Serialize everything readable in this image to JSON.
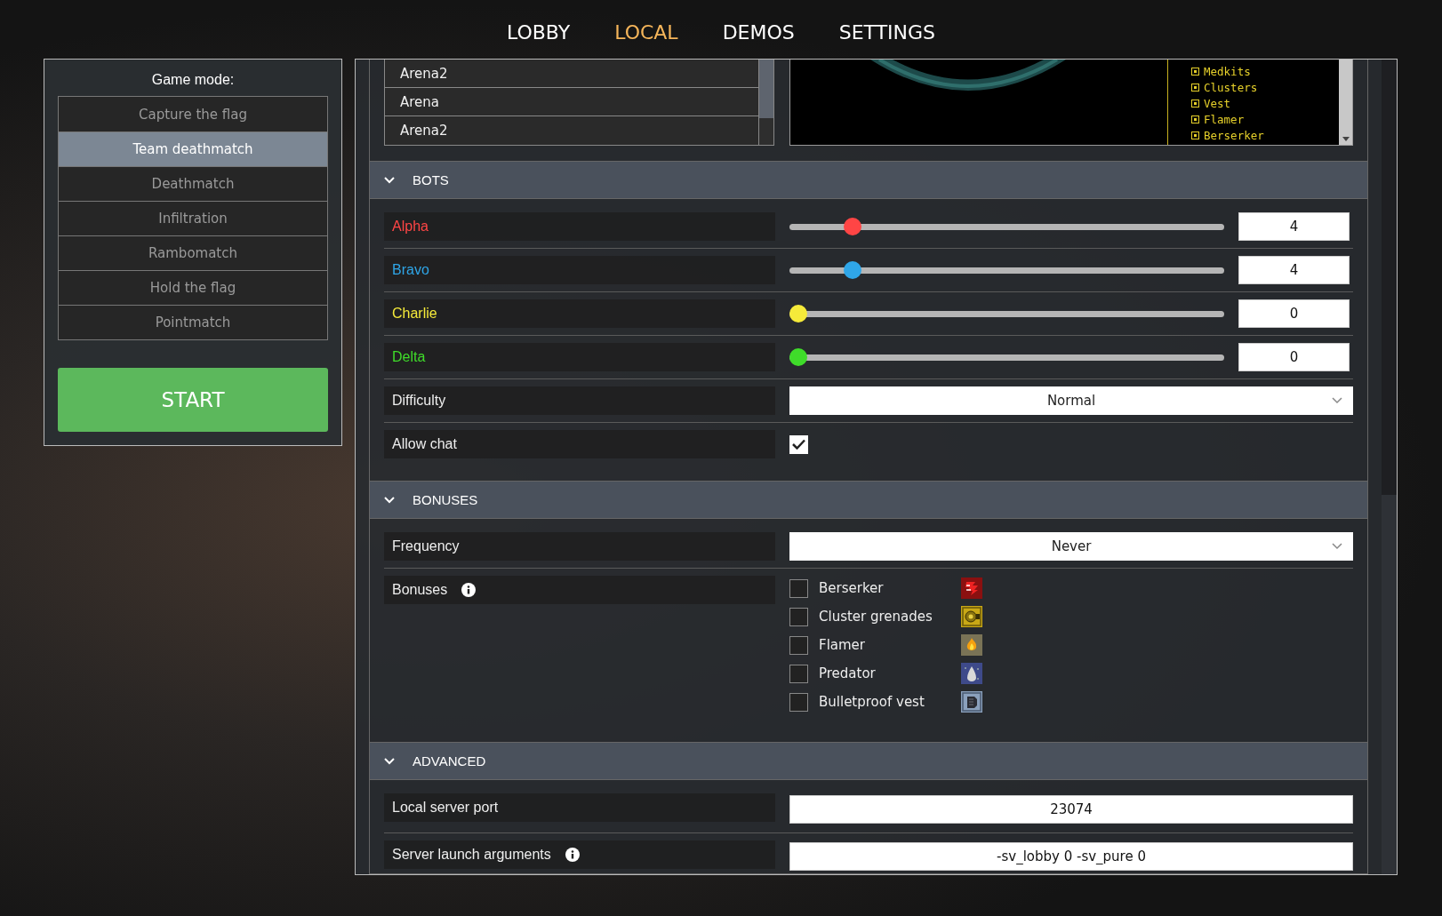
{
  "nav": [
    {
      "label": "LOBBY",
      "selected": false
    },
    {
      "label": "LOCAL",
      "selected": true
    },
    {
      "label": "DEMOS",
      "selected": false
    },
    {
      "label": "SETTINGS",
      "selected": false
    }
  ],
  "game_mode": {
    "title": "Game mode:",
    "modes": [
      {
        "label": "Capture the flag",
        "selected": false
      },
      {
        "label": "Team deathmatch",
        "selected": true
      },
      {
        "label": "Deathmatch",
        "selected": false
      },
      {
        "label": "Infiltration",
        "selected": false
      },
      {
        "label": "Rambomatch",
        "selected": false
      },
      {
        "label": "Hold the flag",
        "selected": false
      },
      {
        "label": "Pointmatch",
        "selected": false
      }
    ],
    "start_button": "START"
  },
  "maps": {
    "list": [
      {
        "name": "Arena2",
        "selected": false
      },
      {
        "name": "Arena",
        "selected": false
      },
      {
        "name": "Arena2",
        "selected": false
      }
    ],
    "preview_items": [
      "Medkits",
      "Clusters",
      "Vest",
      "Flamer",
      "Berserker"
    ]
  },
  "sections": [
    {
      "title": "BOTS",
      "expanded": true,
      "rows": [
        {
          "kind": "slider",
          "label": "Alpha",
          "color": "#ff4545",
          "level": 0.13,
          "value": "4"
        },
        {
          "kind": "slider",
          "label": "Bravo",
          "color": "#2fa6e8",
          "level": 0.13,
          "value": "4"
        },
        {
          "kind": "slider",
          "label": "Charlie",
          "color": "#f5ea3a",
          "level": 0,
          "value": "0"
        },
        {
          "kind": "slider",
          "label": "Delta",
          "color": "#3fdc2a",
          "level": 0,
          "value": "0"
        },
        {
          "kind": "dropdown",
          "label": "Difficulty",
          "value": "Normal"
        },
        {
          "kind": "checkbox",
          "label": "Allow chat",
          "checked": true
        }
      ]
    },
    {
      "title": "BONUSES",
      "expanded": true,
      "rows": [
        {
          "kind": "dropdown",
          "label": "Frequency",
          "value": "Never"
        },
        {
          "kind": "checklist",
          "label": "Bonuses",
          "info": true,
          "items": [
            {
              "label": "Berserker",
              "checked": false
            },
            {
              "label": "Cluster grenades",
              "checked": false
            },
            {
              "label": "Flamer",
              "checked": false
            },
            {
              "label": "Predator",
              "checked": false
            },
            {
              "label": "Bulletproof vest",
              "checked": false
            }
          ]
        }
      ]
    },
    {
      "title": "ADVANCED",
      "expanded": true,
      "rows": [
        {
          "kind": "text",
          "label": "Local server port",
          "value": "23074"
        },
        {
          "kind": "text",
          "label": "Server launch arguments",
          "info": true,
          "value": "-sv_lobby 0 -sv_pure 0"
        }
      ]
    }
  ]
}
